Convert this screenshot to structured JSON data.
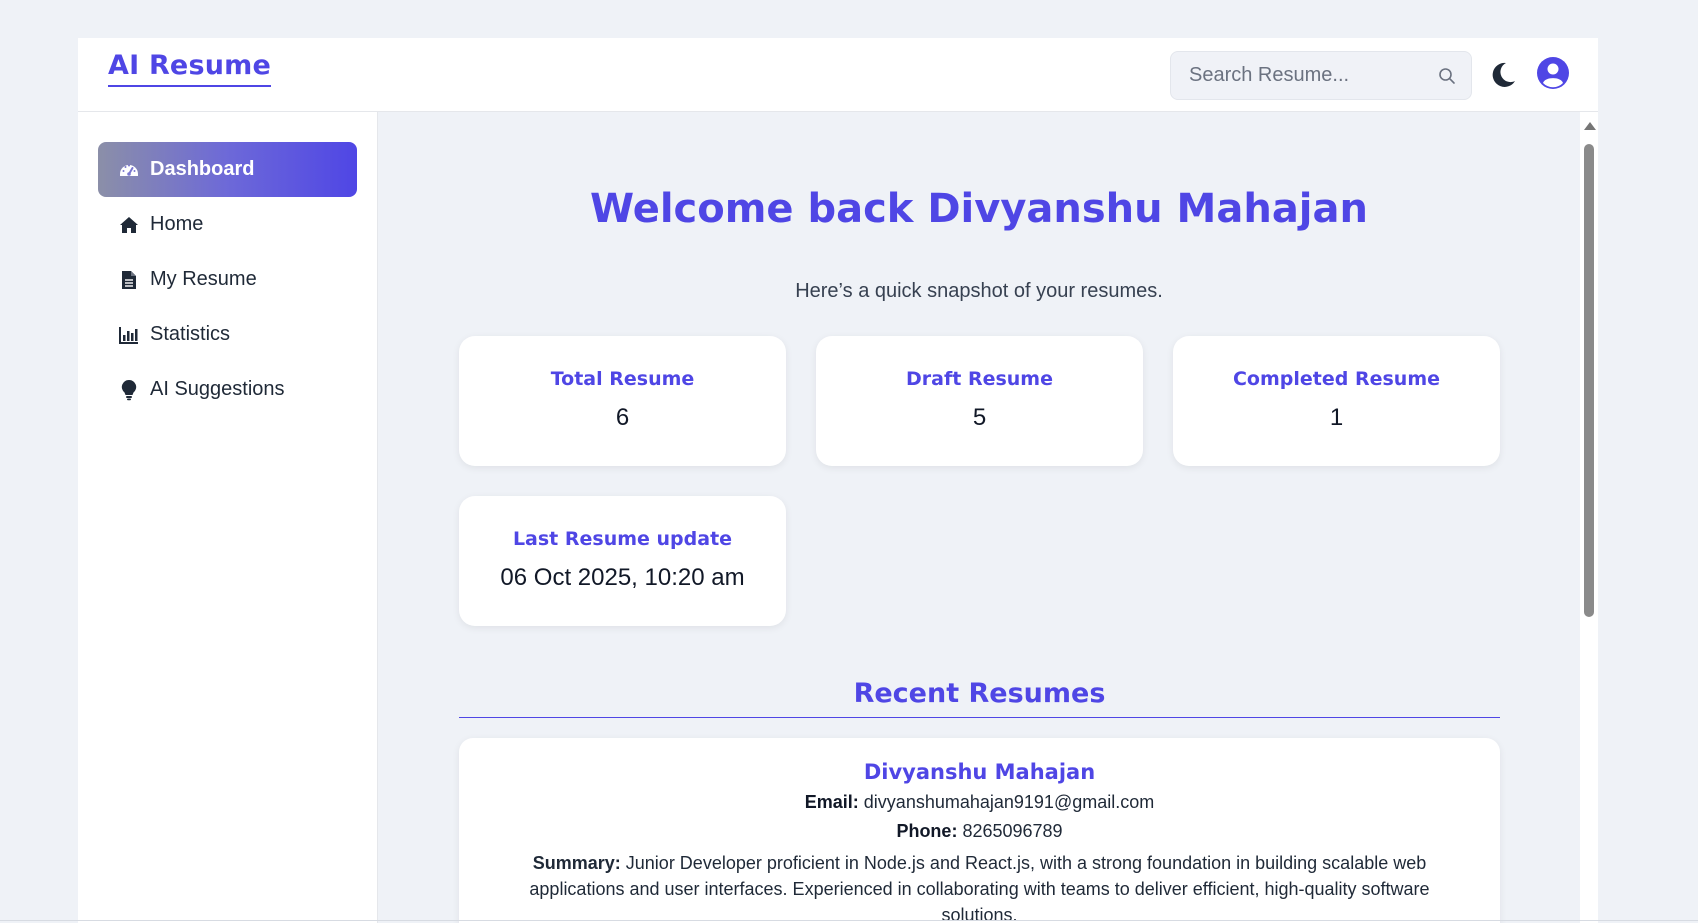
{
  "app": {
    "brand": "AI Resume"
  },
  "header": {
    "search_placeholder": "Search Resume...",
    "search_icon": "search-icon",
    "theme_icon": "moon-icon",
    "profile_icon": "user-circle-icon"
  },
  "sidebar": {
    "items": [
      {
        "label": "Dashboard",
        "icon": "gauge-icon",
        "active": true
      },
      {
        "label": "Home",
        "icon": "home-icon"
      },
      {
        "label": "My Resume",
        "icon": "document-icon"
      },
      {
        "label": "Statistics",
        "icon": "bar-chart-icon"
      },
      {
        "label": "AI Suggestions",
        "icon": "lightbulb-icon"
      }
    ]
  },
  "main": {
    "welcome": "Welcome back Divyanshu Mahajan",
    "subtitle": "Here’s a quick snapshot of your resumes.",
    "stats": [
      {
        "title": "Total Resume",
        "value": "6"
      },
      {
        "title": "Draft Resume",
        "value": "5"
      },
      {
        "title": "Completed Resume",
        "value": "1"
      },
      {
        "title": "Last Resume update",
        "value": "06 Oct 2025, 10:20 am"
      }
    ],
    "recent_title": "Recent Resumes",
    "recent": [
      {
        "name": "Divyanshu Mahajan",
        "email_label": "Email:",
        "email": "divyanshumahajan9191@gmail.com",
        "phone_label": "Phone:",
        "phone": "8265096789",
        "summary_label": "Summary:",
        "summary": "Junior Developer proficient in Node.js and React.js, with a strong foundation in building scalable web applications and user interfaces. Experienced in collaborating with teams to deliver efficient, high-quality software solutions."
      }
    ]
  },
  "colors": {
    "accent": "#4f46e5",
    "background": "#eff2f7",
    "text": "#1f2937"
  }
}
